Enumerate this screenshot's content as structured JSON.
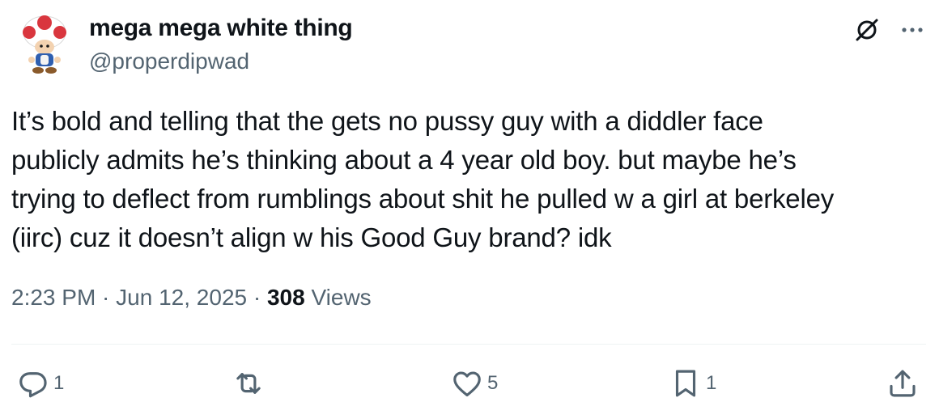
{
  "author": {
    "display_name": "mega mega white thing",
    "handle": "@properdipwad",
    "avatar_icon": "toad-avatar"
  },
  "header_icons": {
    "grok": "grok-icon",
    "more": "more-options-icon"
  },
  "tweet": {
    "text": "It’s bold and telling that the gets no pussy guy with a diddler face\npublicly admits he’s thinking about a 4 year old boy. but maybe he’s\ntrying to deflect from rumblings about shit he pulled w a girl at berkeley\n(iirc) cuz it doesn’t align w his Good Guy brand? idk"
  },
  "meta": {
    "time": "2:23 PM",
    "sep1": " · ",
    "date": "Jun 12, 2025",
    "sep2": " · ",
    "views_count": "308",
    "views_label": " Views"
  },
  "actions": {
    "reply": {
      "icon": "reply-icon",
      "count": "1"
    },
    "repost": {
      "icon": "repost-icon",
      "count": ""
    },
    "like": {
      "icon": "heart-icon",
      "count": "5"
    },
    "bookmark": {
      "icon": "bookmark-icon",
      "count": "1"
    },
    "share": {
      "icon": "share-icon",
      "count": ""
    }
  },
  "colors": {
    "text_primary": "#0f1419",
    "text_secondary": "#536471",
    "divider": "#eff3f4",
    "toad_red": "#d9363e"
  }
}
